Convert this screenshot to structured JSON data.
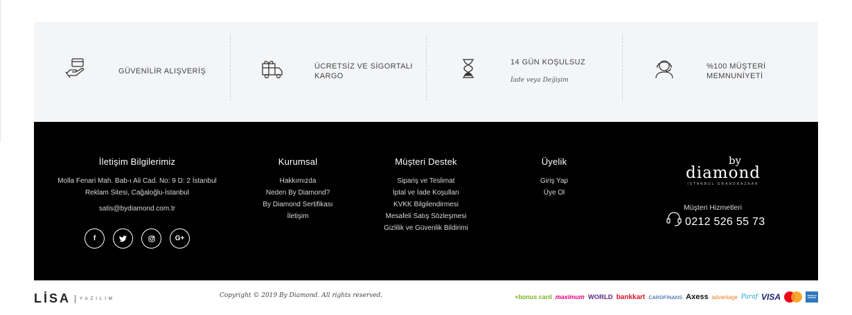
{
  "features": [
    {
      "icon": "hand-card-icon",
      "title": "GÜVENİLİR ALIŞVERİŞ",
      "subtitle": ""
    },
    {
      "icon": "gift-truck-icon",
      "title": "ÜCRETSİZ VE SİGORTALI KARGO",
      "subtitle": ""
    },
    {
      "icon": "hourglass-icon",
      "title": "14 GÜN KOŞULSUZ",
      "subtitle": "İade veya Değişim"
    },
    {
      "icon": "support-agent-icon",
      "title": "%100 MÜŞTERİ MEMNUNİYETİ",
      "subtitle": ""
    }
  ],
  "contact": {
    "heading": "İletişim Bilgilerimiz",
    "address_line1": "Molla Fenari Mah. Bab-ı Ali Cad. No: 9 D: 2 İstanbul",
    "address_line2": "Reklam Sitesi, Cağaloğlu-İstanbul",
    "email": "satis@bydiamond.com.tr",
    "socials": [
      {
        "name": "facebook",
        "glyph": "f"
      },
      {
        "name": "twitter",
        "glyph": "🐦"
      },
      {
        "name": "instagram",
        "glyph": "◎"
      },
      {
        "name": "google-plus",
        "glyph": "G+"
      }
    ]
  },
  "corporate": {
    "heading": "Kurumsal",
    "links": [
      "Hakkımızda",
      "Neden By Diamond?",
      "By Diamond Sertifikası",
      "İletişim"
    ]
  },
  "support": {
    "heading": "Müşteri Destek",
    "links": [
      "Sipariş ve Teslimat",
      "İptal ve İade Koşulları",
      "KVKK Bilgilendirmesi",
      "Mesafeli Satış Sözleşmesi",
      "Gizlilik ve Güvenlik Bildirimi"
    ]
  },
  "membership": {
    "heading": "Üyelik",
    "links": [
      "Giriş Yap",
      "Üye Ol"
    ]
  },
  "brand": {
    "by": "by",
    "name": "diamond",
    "sub": "ISTANBUL GRANDBAZAAR"
  },
  "customer_service": {
    "label": "Müşteri Hizmetleri",
    "phone": "0212 526 55 73"
  },
  "bottom": {
    "lisa_main": "LİSA",
    "lisa_sub": "YAZILIM",
    "copyright": "Copyright © 2019 By Diamond. All rights reserved.",
    "cards": {
      "bonus": "+bonus card",
      "maximum": "maximum",
      "world": "WORLD",
      "bankkart": "bankkart",
      "cardfinans": "CARDFİNANS",
      "axess": "Axess",
      "advantage": "advantage",
      "paraf": "Paraf",
      "visa": "VISA",
      "amex": "AMERICAN EXPRESS"
    }
  }
}
